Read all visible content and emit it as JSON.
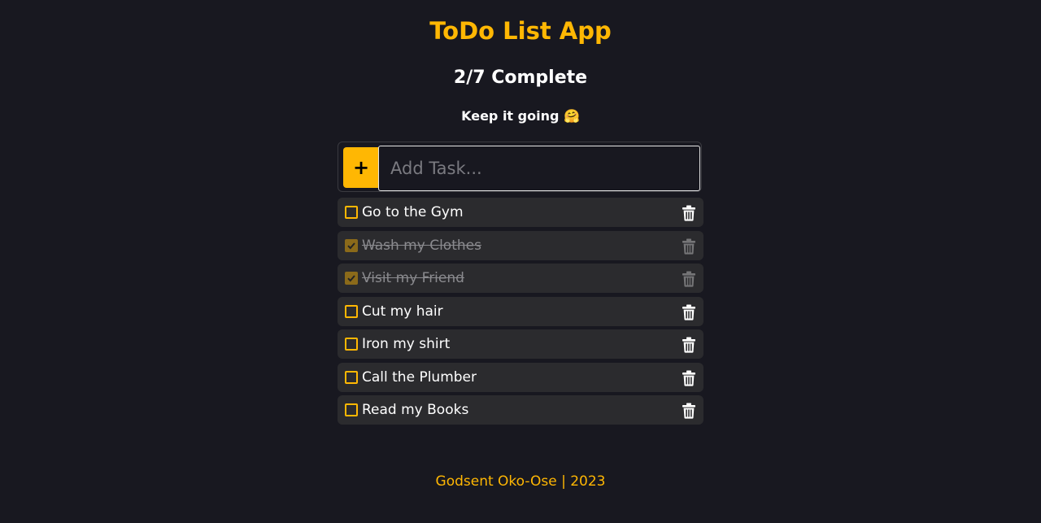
{
  "app": {
    "title": "ToDo List App",
    "progress_text": "2/7 Complete",
    "motivation": "Keep it going 🤗"
  },
  "add_task": {
    "button_label": "+",
    "placeholder": "Add Task..."
  },
  "tasks": [
    {
      "label": "Go to the Gym",
      "done": false
    },
    {
      "label": "Wash my Clothes",
      "done": true
    },
    {
      "label": "Visit my Friend",
      "done": true
    },
    {
      "label": "Cut my hair",
      "done": false
    },
    {
      "label": "Iron my shirt",
      "done": false
    },
    {
      "label": "Call the Plumber",
      "done": false
    },
    {
      "label": "Read my Books",
      "done": false
    }
  ],
  "footer": {
    "credit": "Godsent Oko-Ose | 2023"
  },
  "colors": {
    "accent": "#FFB703",
    "background": "#181820",
    "task_background": "#2b2b2e",
    "text": "#FFFFFF"
  },
  "icons": {
    "add": "plus-icon",
    "delete": "trash-icon",
    "checked": "check-icon"
  }
}
